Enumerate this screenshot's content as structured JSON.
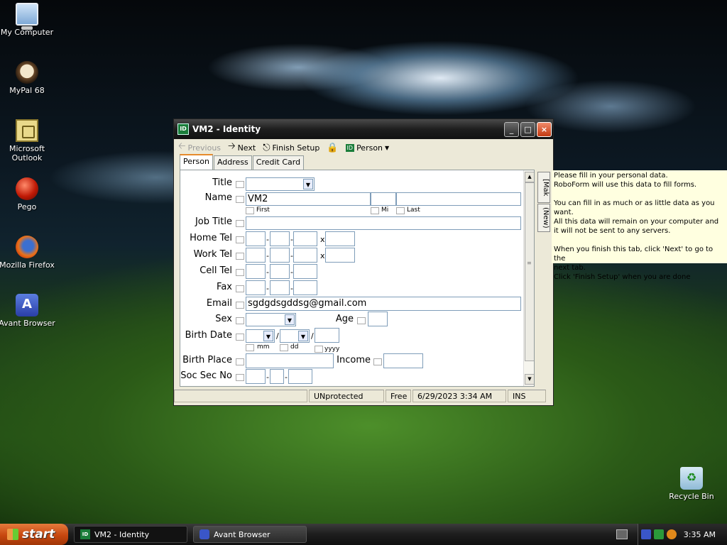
{
  "desktop": {
    "icons": [
      {
        "label": "My Computer",
        "icon": "my-computer-icon"
      },
      {
        "label": "MyPal 68",
        "icon": "mypal-icon"
      },
      {
        "label": "Microsoft Outlook",
        "icon": "outlook-icon"
      },
      {
        "label": "Pego",
        "icon": "pego-icon"
      },
      {
        "label": "Mozilla Firefox",
        "icon": "firefox-icon"
      },
      {
        "label": "Avant Browser",
        "icon": "avant-browser-icon"
      },
      {
        "label": "Recycle Bin",
        "icon": "recycle-bin-icon"
      }
    ]
  },
  "window": {
    "title": "VM2 - Identity",
    "app_icon_text": "ID",
    "controls": {
      "minimize": "_",
      "maximize": "□",
      "close": "×"
    },
    "toolbar": {
      "previous": "Previous",
      "next": "Next",
      "finish_setup": "Finish Setup",
      "person": "Person"
    },
    "tabs": [
      "Person",
      "Address",
      "Credit Card"
    ],
    "form": {
      "title_label": "Title",
      "title_value": "",
      "name_label": "Name",
      "name_first": "VM2",
      "name_mi": "",
      "name_last": "",
      "sub_first": "First",
      "sub_mi": "Mi",
      "sub_last": "Last",
      "job_title_label": "Job Title",
      "home_tel_label": "Home Tel",
      "work_tel_label": "Work Tel",
      "cell_tel_label": "Cell Tel",
      "fax_label": "Fax",
      "email_label": "Email",
      "email_value": "sgdgdsgddsg@gmail.com",
      "sex_label": "Sex",
      "age_label": "Age",
      "birth_date_label": "Birth Date",
      "sub_mm": "mm",
      "sub_dd": "dd",
      "sub_yyyy": "yyyy",
      "birth_place_label": "Birth Place",
      "income_label": "Income",
      "ssn_label": "Soc Sec No",
      "dash": "-",
      "ext": "x",
      "slash": "/"
    },
    "statusbar": {
      "protection": "UNprotected",
      "license": "Free",
      "datetime": "6/29/2023 3:34 AM",
      "mode": "INS"
    },
    "side_tabs": [
      "[Mak",
      "(New)"
    ]
  },
  "help_text": "Please fill in your personal data.\nRoboForm will use this data to fill forms.\n\nYou can fill in as much or as little data as you want.\nAll this data will remain on your computer and\nit will not be sent to any servers.\n\nWhen you finish this tab, click 'Next' to go to the\nnext tab.\nClick 'Finish Setup' when you are done",
  "taskbar": {
    "start_label": "start",
    "tasks": [
      {
        "label": "VM2 - Identity",
        "active": true
      },
      {
        "label": "Avant Browser",
        "active": false
      }
    ],
    "clock": "3:35 AM"
  }
}
